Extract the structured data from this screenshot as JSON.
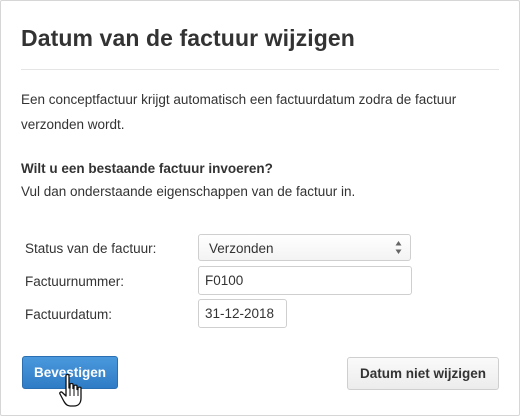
{
  "dialog": {
    "title": "Datum van de factuur wijzigen",
    "intro": "Een conceptfactuur krijgt automatisch een factuurdatum zodra de factuur verzonden wordt.",
    "question": "Wilt u een bestaande factuur invoeren?",
    "hint": "Vul dan onderstaande eigenschappen van de factuur in."
  },
  "form": {
    "status_label": "Status van de factuur:",
    "status_value": "Verzonden",
    "number_label": "Factuurnummer:",
    "number_value": "F0100",
    "date_label": "Factuurdatum:",
    "date_value": "31-12-2018"
  },
  "buttons": {
    "confirm_label": "Bevestigen",
    "cancel_label": "Datum niet wijzigen"
  },
  "colors": {
    "primary": "#2f7cc6",
    "text": "#333333",
    "border": "#cfcfcf"
  },
  "icons": {
    "select_arrows": "up-down-arrows-icon",
    "cursor": "hand-pointer-icon"
  }
}
